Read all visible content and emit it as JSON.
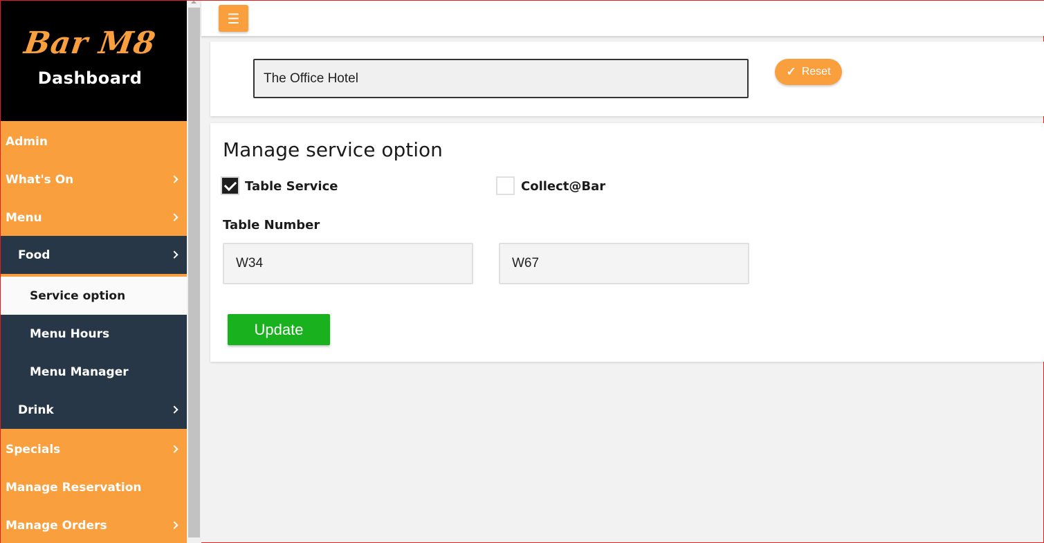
{
  "logo": {
    "script": "Bar M8",
    "subtitle": "Dashboard"
  },
  "sidebar": {
    "items": [
      {
        "label": "Admin"
      },
      {
        "label": "What's On"
      },
      {
        "label": "Menu"
      },
      {
        "label": "Food"
      },
      {
        "label": "Service option"
      },
      {
        "label": "Menu Hours"
      },
      {
        "label": "Menu Manager"
      },
      {
        "label": "Drink"
      },
      {
        "label": "Specials"
      },
      {
        "label": "Manage Reservation"
      },
      {
        "label": "Manage Orders"
      }
    ]
  },
  "topbar": {
    "menu_icon": "hamburger-icon"
  },
  "venue": {
    "value": "The Office Hotel",
    "reset_label": "Reset"
  },
  "service": {
    "title": "Manage service option",
    "options": [
      {
        "label": "Table Service",
        "checked": true
      },
      {
        "label": "Collect@Bar",
        "checked": false
      }
    ],
    "table_number_label": "Table Number",
    "table_numbers": [
      "W34",
      "W67"
    ],
    "update_label": "Update"
  },
  "colors": {
    "accent": "#fa9f3e",
    "sidebar_dark": "#283747",
    "success": "#19b21e",
    "logo_bg": "#000000"
  }
}
